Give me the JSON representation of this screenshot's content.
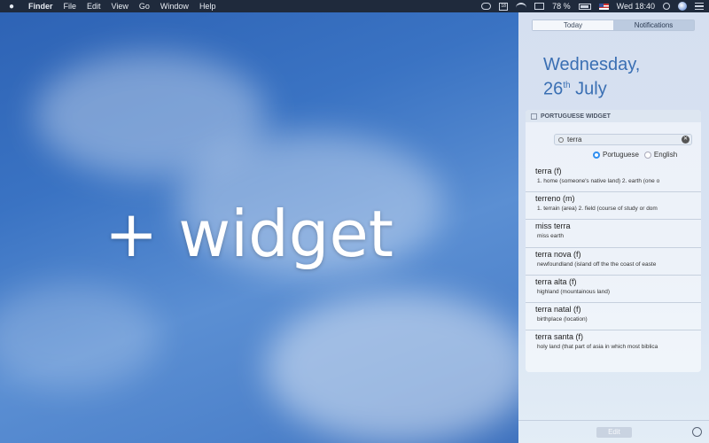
{
  "menubar": {
    "app": "Finder",
    "items": [
      "File",
      "Edit",
      "View",
      "Go",
      "Window",
      "Help"
    ],
    "battery": "78 %",
    "clock": "Wed 18:40"
  },
  "overlay": {
    "text": "+ widget"
  },
  "notification_center": {
    "tabs": [
      {
        "label": "Today",
        "active": true
      },
      {
        "label": "Notifications",
        "active": false
      }
    ],
    "date_line1": "Wednesday,",
    "date_day": "26",
    "date_suffix": "th",
    "date_month": "July",
    "edit_label": "Edit"
  },
  "widget": {
    "title": "PORTUGUESE WIDGET",
    "search_value": "terra",
    "languages": [
      {
        "label": "Portuguese",
        "selected": true
      },
      {
        "label": "English",
        "selected": false
      }
    ],
    "results": [
      {
        "term": "terra (f)",
        "definition": "1. home (someone's native land) 2. earth (one o"
      },
      {
        "term": "terreno (m)",
        "definition": "1. terrain (area) 2. field (course of study or dom"
      },
      {
        "term": "miss terra",
        "definition": "miss earth"
      },
      {
        "term": "terra nova (f)",
        "definition": "newfoundland (island off the the coast of easte"
      },
      {
        "term": "terra alta (f)",
        "definition": "highland (mountainous land)"
      },
      {
        "term": "terra natal (f)",
        "definition": "birthplace (location)"
      },
      {
        "term": "terra santa (f)",
        "definition": "holy land (that part of asia in which most biblica"
      }
    ]
  },
  "colors": {
    "accent": "#3a6fb3",
    "radio_selected": "#2f8ef0",
    "menubar_bg": "#1f2a3c"
  }
}
